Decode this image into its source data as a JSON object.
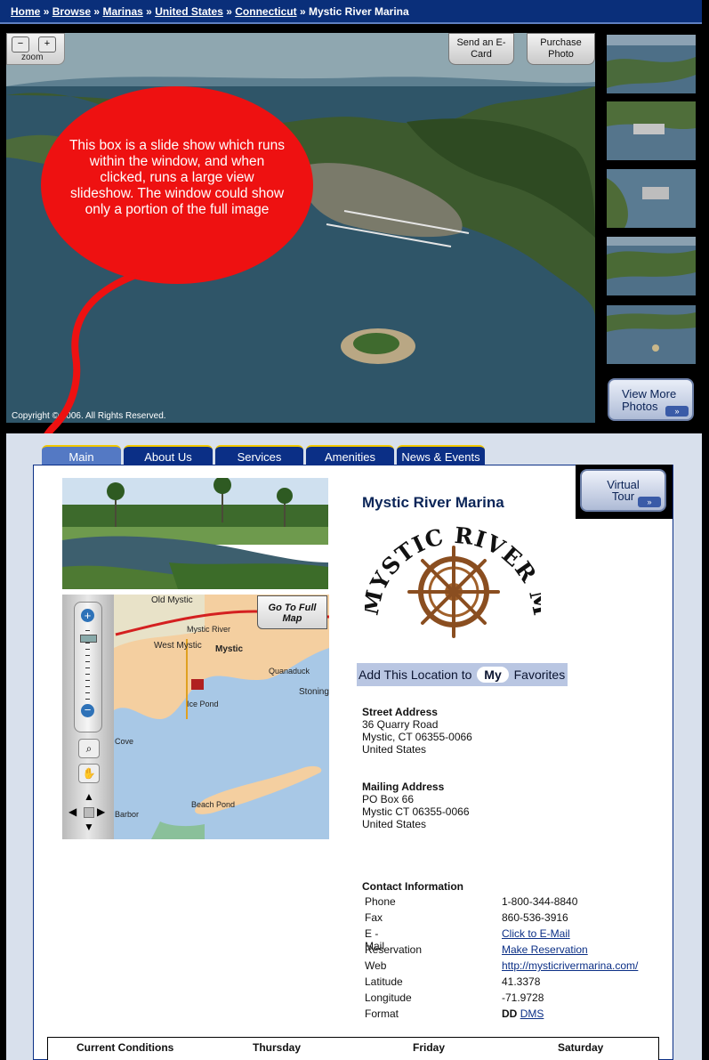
{
  "breadcrumb": {
    "items": [
      "Home",
      "Browse",
      "Marinas",
      "United States",
      "Connecticut"
    ],
    "separator": "»",
    "current": "Mystic River Marina"
  },
  "photo": {
    "zoom_label": "zoom",
    "send_ecard": "Send an E-Card",
    "purchase_photo": "Purchase Photo",
    "copyright": "Copyright © 2006. All Rights Reserved."
  },
  "callout": {
    "text": "This box is a slide show which runs within the window, and when clicked, runs a large view slideshow.  The window could show only a portion of the full image",
    "color": "#ee1111"
  },
  "thumbnails_count": 5,
  "view_more": "View More Photos",
  "tabs": [
    "Main",
    "About Us",
    "Services",
    "Amenities",
    "News & Events"
  ],
  "active_tab": "Main",
  "virtual_tour": "Virtual Tour",
  "map": {
    "go_full": "Go To Full Map",
    "labels": [
      "Old Mystic",
      "West Mystic",
      "Mystic River",
      "Mystic",
      "Quanaduck",
      "Stoning",
      "Ice Pond",
      "Cove",
      "Beach Pond",
      "Barbor"
    ]
  },
  "marina": {
    "name": "Mystic River Marina",
    "logo_text": "MYSTIC RIVER MARINA"
  },
  "favorites": {
    "before": "Add This Location to",
    "my": "My",
    "after": "Favorites"
  },
  "street_address": {
    "label": "Street Address",
    "line1": "36 Quarry Road",
    "line2": "Mystic, CT 06355-0066",
    "line3": "United States"
  },
  "mailing_address": {
    "label": "Mailing Address",
    "line1": "PO Box 66",
    "line2": "Mystic CT 06355-0066",
    "line3": "United States"
  },
  "contact": {
    "title": "Contact Information",
    "rows": [
      {
        "key": "Phone",
        "value": "1-800-344-8840",
        "link": false
      },
      {
        "key": "Fax",
        "value": "860-536-3916",
        "link": false
      },
      {
        "key": "E - Mail",
        "value": "Click to E-Mail",
        "link": true
      },
      {
        "key": "Reservation",
        "value": "Make Reservation",
        "link": true
      },
      {
        "key": "Web",
        "value": "http://mysticrivermarina.com/",
        "link": true
      },
      {
        "key": "Latitude",
        "value": "41.3378",
        "link": false
      },
      {
        "key": "Longitude",
        "value": "-71.9728",
        "link": false
      }
    ],
    "format_key": "Format",
    "format_dd": "DD",
    "format_dms": "DMS"
  },
  "conditions": {
    "title": "Current Conditions",
    "days": [
      "Thursday",
      "Friday",
      "Saturday"
    ]
  },
  "colors": {
    "nav_blue": "#0b2f86",
    "callout_red": "#ee1111",
    "tab_active": "#5479c4"
  }
}
